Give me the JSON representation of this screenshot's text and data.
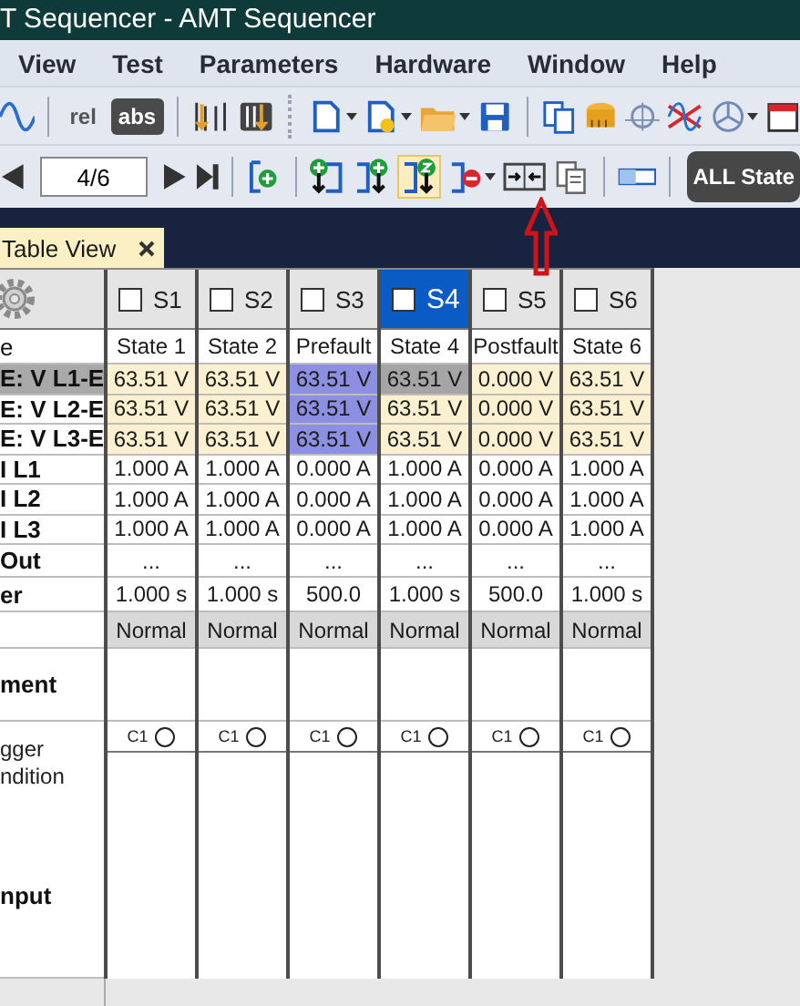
{
  "window": {
    "title": "T Sequencer - AMT Sequencer"
  },
  "menu": [
    "View",
    "Test",
    "Parameters",
    "Hardware",
    "Window",
    "Help"
  ],
  "toolbar_1": {
    "buttons": [
      {
        "label": "rel",
        "kind": "plain"
      },
      {
        "label": "abs",
        "kind": "dark"
      }
    ]
  },
  "toolbar_2": {
    "position": "4/6",
    "zero_state_active": true,
    "all_state_button": "ALL State"
  },
  "tab": {
    "label": "Table View",
    "selected": true
  },
  "table": {
    "columns": [
      {
        "label": "S1",
        "checked": false,
        "selected": false
      },
      {
        "label": "S2",
        "checked": false,
        "selected": false
      },
      {
        "label": "S3",
        "checked": false,
        "selected": false
      },
      {
        "label": "S4",
        "checked": false,
        "selected": true
      },
      {
        "label": "S5",
        "checked": false,
        "selected": false
      },
      {
        "label": "S6",
        "checked": false,
        "selected": false
      }
    ],
    "rows": [
      {
        "kind": "name",
        "label": "e",
        "selected": false,
        "cells": [
          {
            "text": "State 1",
            "kind": "plain"
          },
          {
            "text": "State 2",
            "kind": "plain"
          },
          {
            "text": "Prefault",
            "kind": "plain"
          },
          {
            "text": "State 4",
            "kind": "plain"
          },
          {
            "text": "Postfault",
            "kind": "plain"
          },
          {
            "text": "State 6",
            "kind": "plain"
          }
        ]
      },
      {
        "kind": "value",
        "label": "E: V L1-E",
        "selected": true,
        "cells": [
          {
            "text": "63.51 V",
            "kind": "voltage"
          },
          {
            "text": "63.51 V",
            "kind": "voltage"
          },
          {
            "text": "63.51 V",
            "kind": "prefault"
          },
          {
            "text": "63.51 V",
            "kind": "focused"
          },
          {
            "text": "0.000 V",
            "kind": "voltage"
          },
          {
            "text": "63.51 V",
            "kind": "voltage"
          }
        ]
      },
      {
        "kind": "value",
        "label": "E: V L2-E",
        "selected": false,
        "cells": [
          {
            "text": "63.51 V",
            "kind": "voltage"
          },
          {
            "text": "63.51 V",
            "kind": "voltage"
          },
          {
            "text": "63.51 V",
            "kind": "prefault"
          },
          {
            "text": "63.51 V",
            "kind": "voltage"
          },
          {
            "text": "0.000 V",
            "kind": "voltage"
          },
          {
            "text": "63.51 V",
            "kind": "voltage"
          }
        ]
      },
      {
        "kind": "value",
        "label": "E: V L3-E",
        "selected": false,
        "cells": [
          {
            "text": "63.51 V",
            "kind": "voltage"
          },
          {
            "text": "63.51 V",
            "kind": "voltage"
          },
          {
            "text": "63.51 V",
            "kind": "prefault"
          },
          {
            "text": "63.51 V",
            "kind": "voltage"
          },
          {
            "text": "0.000 V",
            "kind": "voltage"
          },
          {
            "text": "63.51 V",
            "kind": "voltage"
          }
        ]
      },
      {
        "kind": "value",
        "label": "I L1",
        "selected": false,
        "cells": [
          {
            "text": "1.000 A",
            "kind": "plain"
          },
          {
            "text": "1.000 A",
            "kind": "plain"
          },
          {
            "text": "0.000 A",
            "kind": "plain"
          },
          {
            "text": "1.000 A",
            "kind": "plain"
          },
          {
            "text": "0.000 A",
            "kind": "plain"
          },
          {
            "text": "1.000 A",
            "kind": "plain"
          }
        ]
      },
      {
        "kind": "value",
        "label": "I L2",
        "selected": false,
        "cells": [
          {
            "text": "1.000 A",
            "kind": "plain"
          },
          {
            "text": "1.000 A",
            "kind": "plain"
          },
          {
            "text": "0.000 A",
            "kind": "plain"
          },
          {
            "text": "1.000 A",
            "kind": "plain"
          },
          {
            "text": "0.000 A",
            "kind": "plain"
          },
          {
            "text": "1.000 A",
            "kind": "plain"
          }
        ]
      },
      {
        "kind": "value",
        "label": "I L3",
        "selected": false,
        "cells": [
          {
            "text": "1.000 A",
            "kind": "plain"
          },
          {
            "text": "1.000 A",
            "kind": "plain"
          },
          {
            "text": "0.000 A",
            "kind": "plain"
          },
          {
            "text": "1.000 A",
            "kind": "plain"
          },
          {
            "text": "0.000 A",
            "kind": "plain"
          },
          {
            "text": "1.000 A",
            "kind": "plain"
          }
        ]
      },
      {
        "kind": "out",
        "label": "Out",
        "selected": false,
        "cells": [
          {
            "text": "...",
            "kind": "plain"
          },
          {
            "text": "...",
            "kind": "plain"
          },
          {
            "text": "...",
            "kind": "plain"
          },
          {
            "text": "...",
            "kind": "plain"
          },
          {
            "text": "...",
            "kind": "plain"
          },
          {
            "text": "...",
            "kind": "plain"
          }
        ]
      },
      {
        "kind": "timer",
        "label": "er",
        "selected": false,
        "cells": [
          {
            "text": "1.000 s",
            "kind": "plain"
          },
          {
            "text": "1.000 s",
            "kind": "plain"
          },
          {
            "text": "500.0",
            "kind": "plain"
          },
          {
            "text": "1.000 s",
            "kind": "plain"
          },
          {
            "text": "500.0",
            "kind": "plain"
          },
          {
            "text": "1.000 s",
            "kind": "plain"
          }
        ]
      },
      {
        "kind": "mode",
        "selected": false,
        "cells": [
          {
            "text": "Normal",
            "kind": "mode"
          },
          {
            "text": "Normal",
            "kind": "mode"
          },
          {
            "text": "Normal",
            "kind": "mode"
          },
          {
            "text": "Normal",
            "kind": "mode"
          },
          {
            "text": "Normal",
            "kind": "mode"
          },
          {
            "text": "Normal",
            "kind": "mode"
          }
        ]
      },
      {
        "kind": "block",
        "label": "ment",
        "selected": false,
        "cells": []
      },
      {
        "kind": "trigger",
        "label_lines": [
          "gger",
          "ndition"
        ],
        "selected": false,
        "cells": [
          {
            "text": "C1",
            "kind": "trigger",
            "on": false
          },
          {
            "text": "C1",
            "kind": "trigger",
            "on": false
          },
          {
            "text": "C1",
            "kind": "trigger",
            "on": false
          },
          {
            "text": "C1",
            "kind": "trigger",
            "on": false
          },
          {
            "text": "C1",
            "kind": "trigger",
            "on": false
          },
          {
            "text": "C1",
            "kind": "trigger",
            "on": false
          }
        ]
      },
      {
        "kind": "input",
        "label": "nput",
        "selected": false,
        "cells": []
      }
    ]
  }
}
